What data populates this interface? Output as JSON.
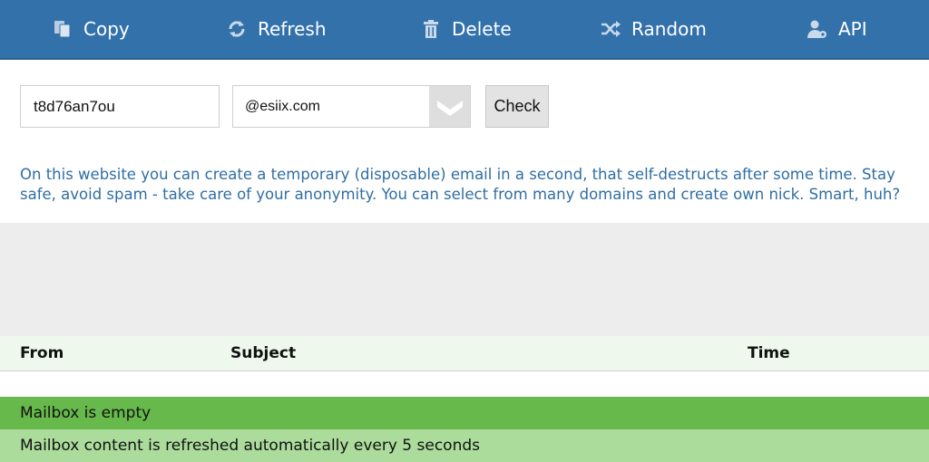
{
  "nav": {
    "copy": {
      "label": "Copy",
      "icon": "copy-icon"
    },
    "refresh": {
      "label": "Refresh",
      "icon": "refresh-icon"
    },
    "delete": {
      "label": "Delete",
      "icon": "trash-icon"
    },
    "random": {
      "label": "Random",
      "icon": "shuffle-icon"
    },
    "api": {
      "label": "API",
      "icon": "user-gear-icon"
    }
  },
  "form": {
    "nick_value": "t8d76an7ou",
    "domain_value": "@esiix.com",
    "check_label": "Check"
  },
  "description": "On this website you can create a temporary (disposable) email in a second, that self-destructs after some time. Stay safe, avoid spam - take care of your anonymity. You can select from many domains and create own nick. Smart, huh?",
  "table": {
    "headers": {
      "from": "From",
      "subject": "Subject",
      "time": "Time"
    }
  },
  "status": {
    "empty": "Mailbox is empty",
    "refresh_note": "Mailbox content is refreshed automatically every 5 seconds"
  },
  "colors": {
    "navbar": "#3371ab",
    "description_text": "#2f6ea3",
    "status_empty_bg": "#67b94b",
    "status_refresh_bg": "#abdc9c"
  }
}
